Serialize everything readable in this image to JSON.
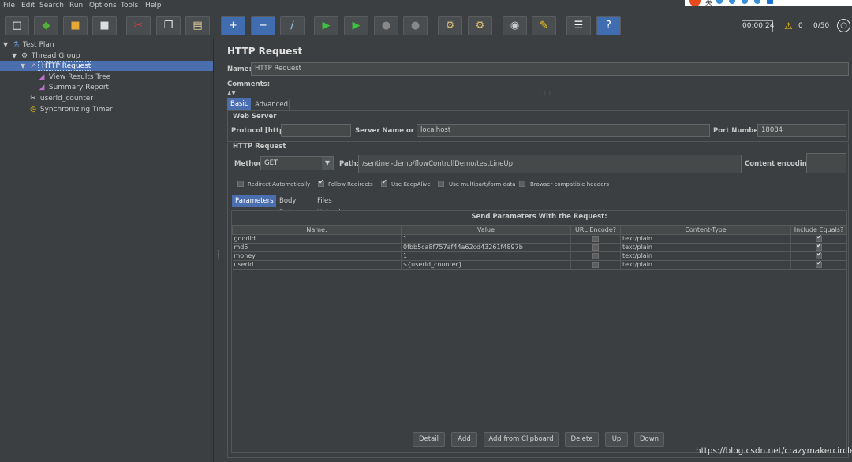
{
  "menu": [
    "File",
    "Edit",
    "Search",
    "Run",
    "Options",
    "Tools",
    "Help"
  ],
  "toolbar": {
    "buttons": [
      {
        "name": "new-icon",
        "glyph": "□",
        "color": "#ffffff"
      },
      {
        "name": "templates-icon",
        "glyph": "◆",
        "color": "#53b13a"
      },
      {
        "name": "open-icon",
        "glyph": "■",
        "color": "#e8a835"
      },
      {
        "name": "save-icon",
        "glyph": "■",
        "color": "#dddddd"
      },
      {
        "name": "cut-icon",
        "glyph": "✂",
        "color": "#e03a3a"
      },
      {
        "name": "copy-icon",
        "glyph": "❐",
        "color": "#dddddd"
      },
      {
        "name": "paste-icon",
        "glyph": "▤",
        "color": "#e8d8a0"
      },
      {
        "name": "expand-icon",
        "glyph": "+",
        "color": "#ffffff"
      },
      {
        "name": "collapse-icon",
        "glyph": "−",
        "color": "#ffffff"
      },
      {
        "name": "toggle-icon",
        "glyph": "∕",
        "color": "#9ad0f0"
      },
      {
        "name": "start-icon",
        "glyph": "▶",
        "color": "#3cc23c"
      },
      {
        "name": "start-no-pause-icon",
        "glyph": "▶",
        "color": "#3cc23c"
      },
      {
        "name": "stop-icon",
        "glyph": "●",
        "color": "#888888"
      },
      {
        "name": "shutdown-icon",
        "glyph": "●",
        "color": "#888888"
      },
      {
        "name": "clear-icon",
        "glyph": "⚙",
        "color": "#e0c070"
      },
      {
        "name": "clear-all-icon",
        "glyph": "⚙",
        "color": "#e0c070"
      },
      {
        "name": "search-icon",
        "glyph": "◉",
        "color": "#cccccc"
      },
      {
        "name": "reset-search-icon",
        "glyph": "✎",
        "color": "#f0c419"
      },
      {
        "name": "function-helper-icon",
        "glyph": "☰",
        "color": "#ffffff"
      },
      {
        "name": "help-icon",
        "glyph": "?",
        "color": "#ffffff"
      }
    ],
    "timer": "00:00:24",
    "warnings": "0",
    "threads": "0/50"
  },
  "tree": [
    {
      "label": "Test Plan",
      "level": 0,
      "toggle": "▼",
      "icon": "⚗"
    },
    {
      "label": "Thread Group",
      "level": 1,
      "toggle": "▼",
      "icon": "⚙"
    },
    {
      "label": "HTTP Request",
      "level": 2,
      "toggle": "▼",
      "icon": "↗",
      "selected": true
    },
    {
      "label": "View Results Tree",
      "level": 3,
      "toggle": "",
      "icon": "◢"
    },
    {
      "label": "Summary Report",
      "level": 3,
      "toggle": "",
      "icon": "◢"
    },
    {
      "label": "userId_counter",
      "level": 2,
      "toggle": "",
      "icon": "✂"
    },
    {
      "label": "Synchronizing Timer",
      "level": 2,
      "toggle": "",
      "icon": "◷"
    }
  ],
  "panel": {
    "title": "HTTP Request",
    "name_label": "Name:",
    "name_value": "HTTP Request",
    "comments_label": "Comments:",
    "tabs": [
      "Basic",
      "Advanced"
    ],
    "web_server": {
      "title": "Web Server",
      "protocol_label": "Protocol [http]:",
      "protocol_value": "",
      "server_label": "Server Name or IP:",
      "server_value": "localhost",
      "port_label": "Port Number:",
      "port_value": "18084"
    },
    "http_request": {
      "title": "HTTP Request",
      "method_label": "Method:",
      "method_value": "GET",
      "path_label": "Path:",
      "path_value": "/sentinel-demo/flowControllDemo/testLineUp",
      "encoding_label": "Content encoding:",
      "encoding_value": ""
    },
    "options": [
      {
        "label": "Redirect Automatically",
        "checked": false
      },
      {
        "label": "Follow Redirects",
        "checked": true
      },
      {
        "label": "Use KeepAlive",
        "checked": true
      },
      {
        "label": "Use multipart/form-data",
        "checked": false
      },
      {
        "label": "Browser-compatible headers",
        "checked": false
      }
    ],
    "sub_tabs": [
      "Parameters",
      "Body Data",
      "Files Upload"
    ],
    "params_heading": "Send Parameters With the Request:",
    "columns": [
      "Name:",
      "Value",
      "URL Encode?",
      "Content-Type",
      "Include Equals?"
    ],
    "rows": [
      {
        "name": "goodId",
        "value": "1",
        "encode": false,
        "type": "text/plain",
        "equals": true
      },
      {
        "name": "md5",
        "value": "0fbb5ca8f757af44a62cd43261f4897b",
        "encode": false,
        "type": "text/plain",
        "equals": true
      },
      {
        "name": "money",
        "value": "1",
        "encode": false,
        "type": "text/plain",
        "equals": true
      },
      {
        "name": "userId",
        "value": "${userId_counter}",
        "encode": false,
        "type": "text/plain",
        "equals": true
      }
    ],
    "buttons": [
      "Detail",
      "Add",
      "Add from Clipboard",
      "Delete",
      "Up",
      "Down"
    ]
  },
  "watermark": "https://blog.csdn.net/crazymakercircle",
  "csdn_widget": "英"
}
